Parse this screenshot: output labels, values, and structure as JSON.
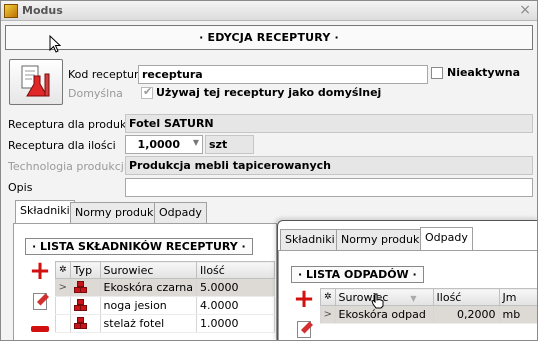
{
  "window": {
    "title": "Modus",
    "close_glyph": "×"
  },
  "header": {
    "title": "· EDYCJA RECEPTURY ·"
  },
  "form": {
    "kod_label": "Kod receptury",
    "kod_value": "receptura",
    "nieaktywna_label": "Nieaktywna",
    "domyslna_label": "Domyślna",
    "domyslna_checkbox_label": "Używaj tej receptury jako domyślnej",
    "produkt_label": "Receptura dla produktu",
    "produkt_value": "Fotel SATURN",
    "ilosc_label": "Receptura dla ilości",
    "ilosc_value": "1,0000",
    "ilosc_unit": "szt",
    "technologia_label": "Technologia produkcji",
    "technologia_value": "Produkcja mebli tapicerowanych",
    "opis_label": "Opis",
    "opis_value": ""
  },
  "tabs": [
    "Składniki",
    "Normy produkcji",
    "Odpady"
  ],
  "skladniki": {
    "section_title": "· LISTA SKŁADNIKÓW RECEPTURY ·",
    "columns": [
      "",
      "Typ",
      "Surowiec",
      "Ilość"
    ],
    "rows": [
      {
        "surowiec": "Ekoskóra czarna",
        "ilosc": "5.0000",
        "selected": true
      },
      {
        "surowiec": "noga jesion",
        "ilosc": "4.0000",
        "selected": false
      },
      {
        "surowiec": "stelaż fotel",
        "ilosc": "1.0000",
        "selected": false
      }
    ]
  },
  "popup": {
    "tabs": [
      "Składniki",
      "Normy produkcji",
      "Odpady"
    ],
    "section_title": "· LISTA ODPADÓW ·",
    "columns": [
      "",
      "Surowiec",
      "Ilość",
      "Jm"
    ],
    "rows": [
      {
        "surowiec": "Ekoskóra odpad",
        "ilosc": "0,2000",
        "jm": "mb"
      }
    ]
  },
  "colors": {
    "accent_red": "#d21010",
    "selected_row": "#ddd9d4"
  }
}
